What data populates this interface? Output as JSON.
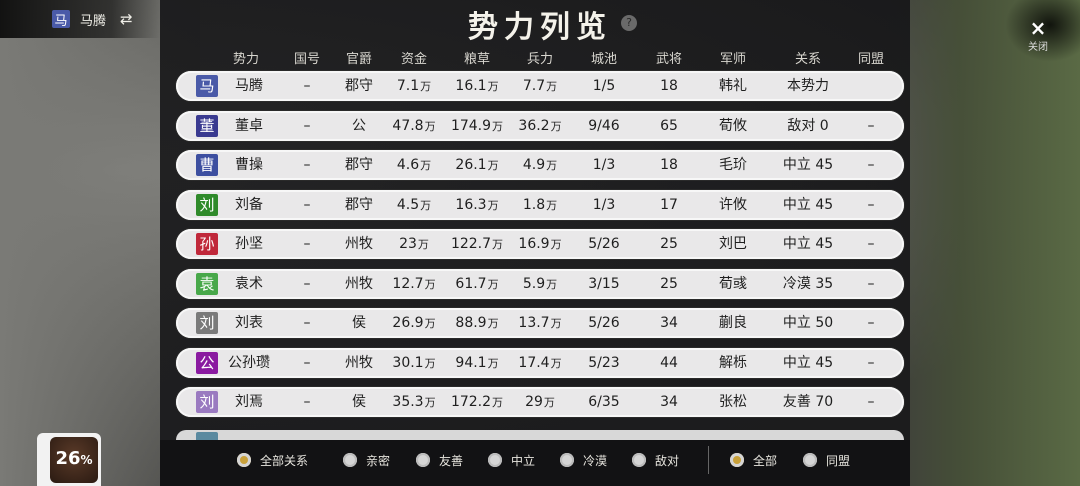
{
  "player": {
    "seal_char": "马",
    "seal_color": "#4a5aa8",
    "name": "马腾",
    "swap_icon": "swap-arrows-icon"
  },
  "title": "势力列览",
  "help_label": "?",
  "close": {
    "icon": "×",
    "label": "关闭"
  },
  "columns": [
    "势力",
    "国号",
    "官爵",
    "资金",
    "粮草",
    "兵力",
    "城池",
    "武将",
    "军师",
    "关系",
    "同盟"
  ],
  "unit": "万",
  "rows": [
    {
      "seal": "马",
      "color": "#4a5aa8",
      "name": "马腾",
      "country": "–",
      "rank": "郡守",
      "gold": "7.1",
      "food": "16.1",
      "troops": "7.7",
      "cities": "1/5",
      "generals": "18",
      "advisor": "韩礼",
      "relation": "本势力",
      "alliance": ""
    },
    {
      "seal": "董",
      "color": "#3a3a90",
      "name": "董卓",
      "country": "–",
      "rank": "公",
      "gold": "47.8",
      "food": "174.9",
      "troops": "36.2",
      "cities": "9/46",
      "generals": "65",
      "advisor": "荀攸",
      "relation": "敌对 0",
      "alliance": "–"
    },
    {
      "seal": "曹",
      "color": "#3d4fa0",
      "name": "曹操",
      "country": "–",
      "rank": "郡守",
      "gold": "4.6",
      "food": "26.1",
      "troops": "4.9",
      "cities": "1/3",
      "generals": "18",
      "advisor": "毛玠",
      "relation": "中立 45",
      "alliance": "–"
    },
    {
      "seal": "刘",
      "color": "#2f8a2a",
      "name": "刘备",
      "country": "–",
      "rank": "郡守",
      "gold": "4.5",
      "food": "16.3",
      "troops": "1.8",
      "cities": "1/3",
      "generals": "17",
      "advisor": "许攸",
      "relation": "中立 45",
      "alliance": "–"
    },
    {
      "seal": "孙",
      "color": "#c0283a",
      "name": "孙坚",
      "country": "–",
      "rank": "州牧",
      "gold": "23",
      "food": "122.7",
      "troops": "16.9",
      "cities": "5/26",
      "generals": "25",
      "advisor": "刘巴",
      "relation": "中立 45",
      "alliance": "–"
    },
    {
      "seal": "袁",
      "color": "#48a84a",
      "name": "袁术",
      "country": "–",
      "rank": "州牧",
      "gold": "12.7",
      "food": "61.7",
      "troops": "5.9",
      "cities": "3/15",
      "generals": "25",
      "advisor": "荀彧",
      "relation": "冷漠 35",
      "alliance": "–"
    },
    {
      "seal": "刘",
      "color": "#7a7a7a",
      "name": "刘表",
      "country": "–",
      "rank": "侯",
      "gold": "26.9",
      "food": "88.9",
      "troops": "13.7",
      "cities": "5/26",
      "generals": "34",
      "advisor": "蒯良",
      "relation": "中立 50",
      "alliance": "–"
    },
    {
      "seal": "公",
      "color": "#8a1aa0",
      "name": "公孙瓒",
      "country": "–",
      "rank": "州牧",
      "gold": "30.1",
      "food": "94.1",
      "troops": "17.4",
      "cities": "5/23",
      "generals": "44",
      "advisor": "解栎",
      "relation": "中立 45",
      "alliance": "–"
    },
    {
      "seal": "刘",
      "color": "#9a7ac0",
      "name": "刘焉",
      "country": "–",
      "rank": "侯",
      "gold": "35.3",
      "food": "172.2",
      "troops": "29",
      "cities": "6/35",
      "generals": "34",
      "advisor": "张松",
      "relation": "友善 70",
      "alliance": "–"
    }
  ],
  "relation_filters": [
    {
      "label": "全部关系",
      "selected": true
    },
    {
      "label": "亲密",
      "selected": false
    },
    {
      "label": "友善",
      "selected": false
    },
    {
      "label": "中立",
      "selected": false
    },
    {
      "label": "冷漠",
      "selected": false
    },
    {
      "label": "敌对",
      "selected": false
    }
  ],
  "alliance_filters": [
    {
      "label": "全部",
      "selected": true
    },
    {
      "label": "同盟",
      "selected": false
    }
  ],
  "progress": {
    "percent": 26,
    "symbol": "%"
  }
}
